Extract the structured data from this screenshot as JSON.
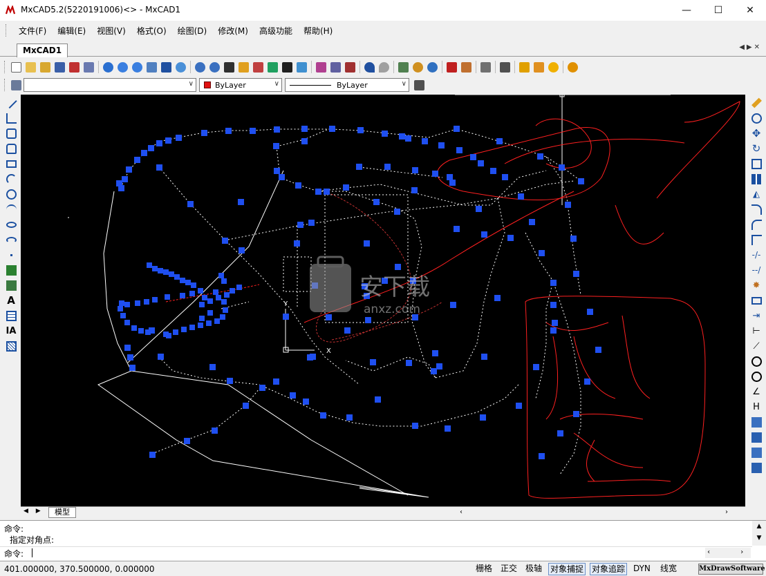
{
  "window": {
    "title": "MxCAD5.2(5220191006)<> - MxCAD1",
    "minimize_glyph": "—",
    "maximize_glyph": "☐",
    "close_glyph": "✕"
  },
  "menu": [
    "文件(F)",
    "编辑(E)",
    "视图(V)",
    "格式(O)",
    "绘图(D)",
    "修改(M)",
    "高级功能",
    "帮助(H)"
  ],
  "tabs": {
    "document": "MxCAD1",
    "nav": "◀▶✕"
  },
  "properties": {
    "layer_value": "",
    "color_value": "ByLayer",
    "color_hex": "#e01010",
    "linetype_value": "ByLayer"
  },
  "bottom": {
    "model_tab": "模型"
  },
  "command": {
    "line1": "命令:",
    "line2": "指定对角点:",
    "prompt": "命令:"
  },
  "status": {
    "coords": "401.000000,  370.500000,  0.000000",
    "buttons": [
      "栅格",
      "正交",
      "极轴",
      "对象捕捉",
      "对象追踪",
      "DYN",
      "线宽"
    ],
    "brand": "MxDrawSoftware"
  },
  "canvas_watermark": {
    "line1": "安下载",
    "line2": "anxz.com"
  }
}
